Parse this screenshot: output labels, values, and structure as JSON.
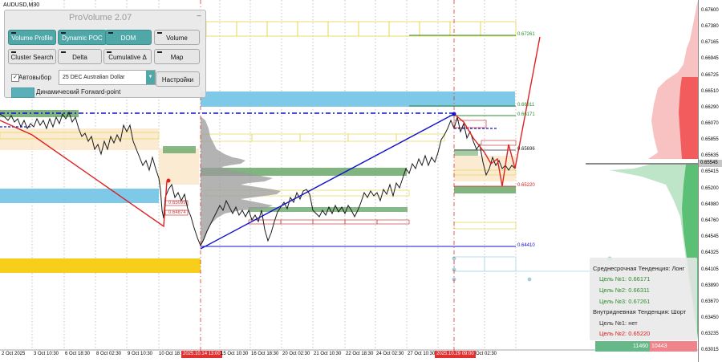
{
  "window": {
    "symbol_label": "AUDUSD,M30"
  },
  "panel": {
    "title": "ProVolume 2.07",
    "minimize_icon": "minimize-icon",
    "buttons": {
      "volume_profile": "Volume Profile",
      "dynamic_poc": "Dynamic POC",
      "dom": "DOM",
      "volume": "Volume",
      "cluster_search": "Cluster Search",
      "delta": "Delta",
      "cumulative_delta": "Cumulative Δ",
      "map": "Map",
      "settings": "Настройки"
    },
    "auto_select_label": "Автовыбор",
    "auto_select_checked": "✓",
    "instrument": "25 DEC Australian Dollar",
    "dropdown_icon": "chevron-down-icon",
    "forward_point_label": "Динамический Forward-point",
    "teal_color": "#4fa7a7"
  },
  "price_axis": {
    "labels": [
      "0.67600",
      "0.67380",
      "0.67165",
      "0.66945",
      "0.66725",
      "0.66510",
      "0.66290",
      "0.66070",
      "0.65855",
      "0.65635",
      "0.65415",
      "0.65200",
      "0.64980",
      "0.64760",
      "0.64545",
      "0.64325",
      "0.64105",
      "0.63890",
      "0.63670",
      "0.63450",
      "0.63235",
      "0.63015"
    ],
    "current": "0.65545"
  },
  "levels": {
    "l1": "0.67261",
    "l2": "0.66311",
    "l3": "0.66171",
    "l4": "0.65696",
    "l5": "0.65220",
    "l6": "0.64410",
    "inner_a": "0.65099",
    "inner_b": "0.64874"
  },
  "time_axis": {
    "labels": [
      "2 Oct 2025",
      "3 Oct 10:30",
      "6 Oct 18:30",
      "8 Oct 02:30",
      "9 Oct 10:30",
      "10 Oct 18:",
      "15 Oct 10:30",
      "16 Oct 18:30",
      "20 Oct 02:30",
      "21 Oct 10:30",
      "22 Oct 18:30",
      "24 Oct 02:30",
      "27 Oct 10:30",
      "Oct 02:30"
    ],
    "badge_1": "2025.10.14 13:00",
    "badge_2": "2025.10.29 09:00"
  },
  "trend": {
    "mid_title": "Среднесрочная Тенденция: Лонг",
    "target1": "Цель №1: 0.66171",
    "target2": "Цель №2: 0.66311",
    "target3": "Цель №3: 0.67261",
    "intraday_title": "Внутридневная Тенденция: Шорт",
    "intra_target1": "Цель №1: нет",
    "intra_target2": "Цель №2: 0.65220"
  },
  "volume_bar": {
    "buy": "11460",
    "sell": "10443"
  },
  "colors": {
    "bull_band": "#6aa86a",
    "light_blue_band": "#7ec8e8",
    "gold_band": "#f7cf1a",
    "trend_blue": "#1010d0",
    "trend_red": "#e02020"
  }
}
